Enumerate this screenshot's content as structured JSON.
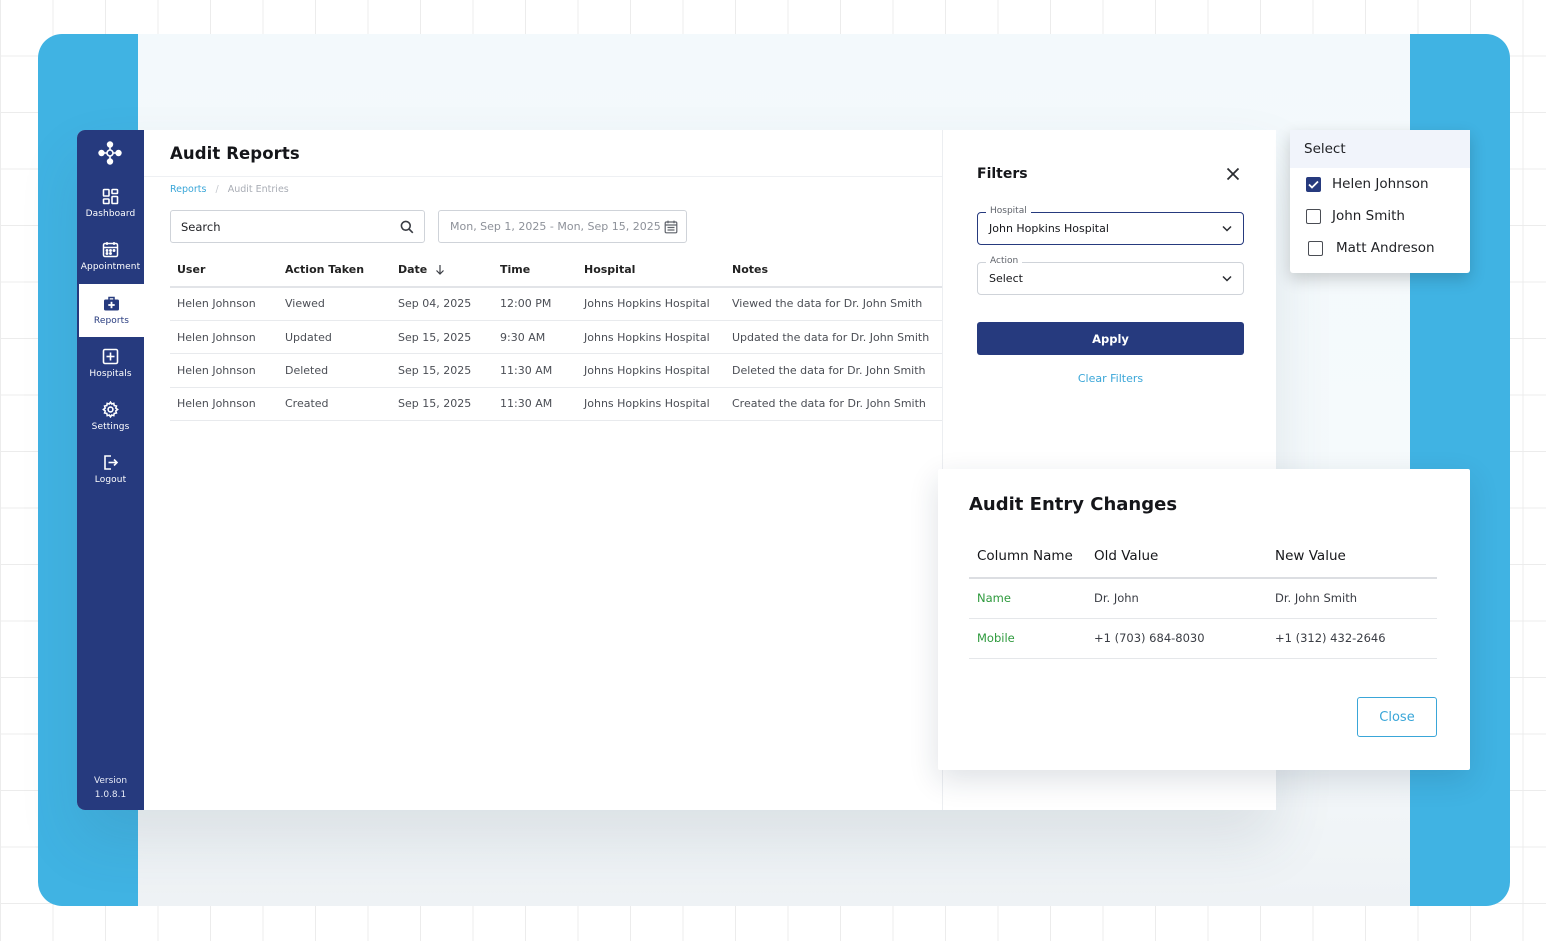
{
  "sidebar": {
    "items": [
      {
        "label": "Dashboard",
        "icon": "dashboard-icon"
      },
      {
        "label": "Appointment",
        "icon": "calendar-icon"
      },
      {
        "label": "Reports",
        "icon": "reports-icon",
        "active": true
      },
      {
        "label": "Hospitals",
        "icon": "hospital-icon"
      },
      {
        "label": "Settings",
        "icon": "gear-icon"
      },
      {
        "label": "Logout",
        "icon": "logout-icon"
      }
    ],
    "version_label": "Version",
    "version_number": "1.0.8.1"
  },
  "page": {
    "title": "Audit Reports",
    "breadcrumb": [
      "Reports",
      "Audit Entries"
    ]
  },
  "search": {
    "placeholder": "Search"
  },
  "date_range": {
    "value": "Mon, Sep 1, 2025 - Mon, Sep 15, 2025"
  },
  "table": {
    "columns": [
      "User",
      "Action Taken",
      "Date",
      "Time",
      "Hospital",
      "Notes"
    ],
    "sorted_column": "Date",
    "rows": [
      [
        "Helen Johnson",
        "Viewed",
        "Sep 04, 2025",
        "12:00 PM",
        "Johns Hopkins Hospital",
        "Viewed the data for Dr. John Smith"
      ],
      [
        "Helen Johnson",
        "Updated",
        "Sep 15, 2025",
        "9:30 AM",
        "Johns Hopkins Hospital",
        "Updated the data for Dr. John Smith"
      ],
      [
        "Helen Johnson",
        "Deleted",
        "Sep 15, 2025",
        "11:30 AM",
        "Johns Hopkins Hospital",
        "Deleted the data for Dr. John Smith"
      ],
      [
        "Helen Johnson",
        "Created",
        "Sep 15, 2025",
        "11:30 AM",
        "Johns Hopkins Hospital",
        "Created the data for Dr. John Smith"
      ]
    ]
  },
  "filters": {
    "title": "Filters",
    "hospital_label": "Hospital",
    "hospital_value": "John Hopkins Hospital",
    "action_label": "Action",
    "action_value": "Select",
    "apply_label": "Apply",
    "clear_label": "Clear Filters"
  },
  "user_dropdown": {
    "header": "Select",
    "options": [
      {
        "label": "Helen Johnson",
        "checked": true
      },
      {
        "label": "John Smith",
        "checked": false
      },
      {
        "label": "Matt Andreson",
        "checked": false
      }
    ]
  },
  "changes_dialog": {
    "title": "Audit Entry Changes",
    "columns": [
      "Column Name",
      "Old Value",
      "New Value"
    ],
    "rows": [
      [
        "Name",
        "Dr. John",
        "Dr. John Smith"
      ],
      [
        "Mobile",
        "+1 (703) 684-8030",
        "+1 (312) 432-2646"
      ]
    ],
    "close_label": "Close"
  },
  "colors": {
    "sidebar_bg": "#263a7e",
    "accent_blue": "#3aa6d8",
    "frame_blue": "#40b3e3",
    "column_name_green": "#2e9a3d"
  }
}
